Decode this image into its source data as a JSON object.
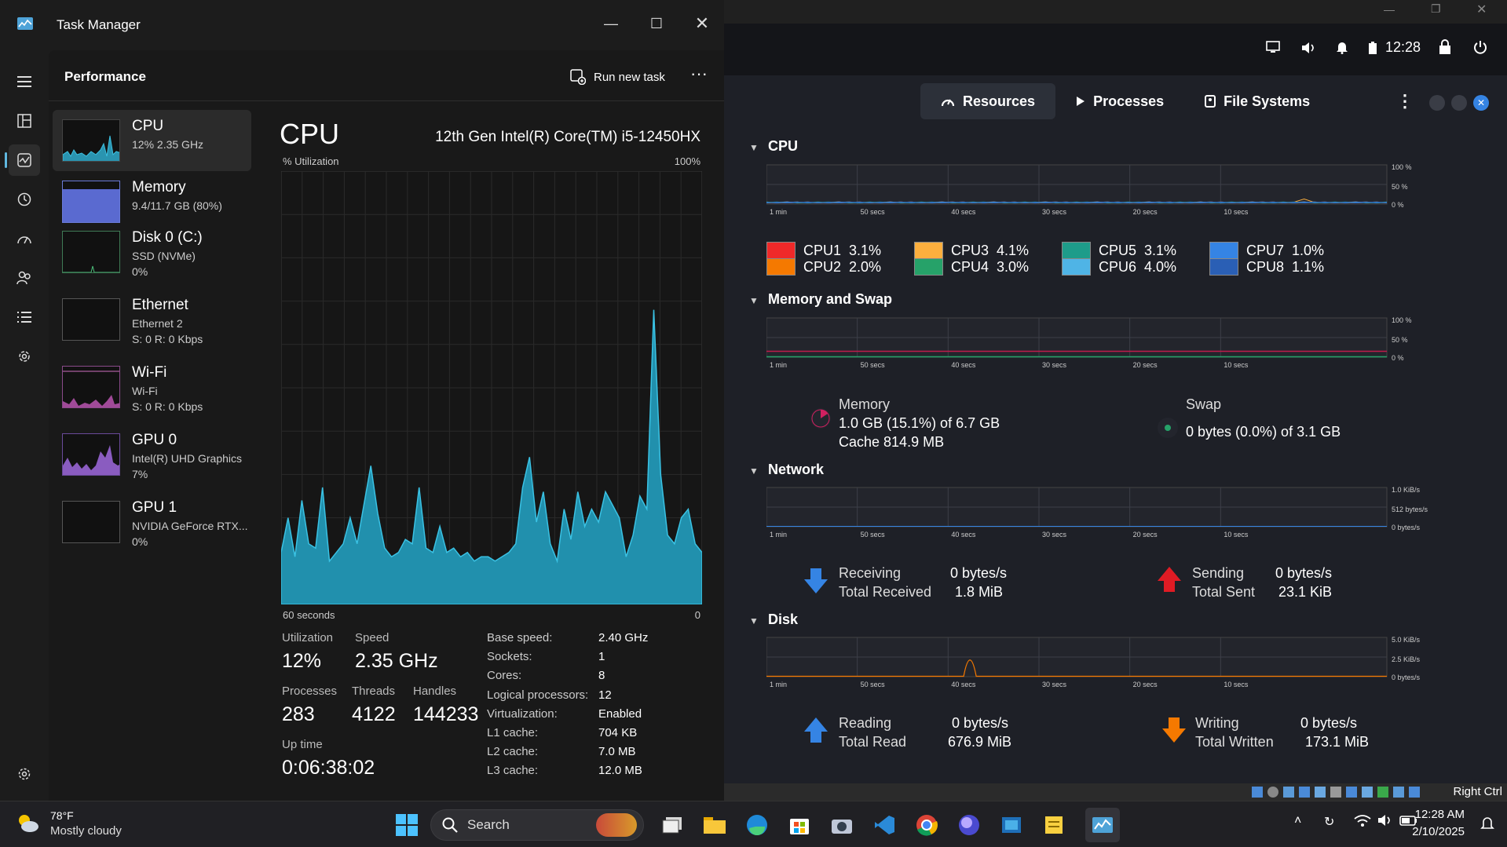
{
  "task_manager": {
    "title": "Task Manager",
    "page_title": "Performance",
    "run_new_task": "Run new task",
    "more": "···",
    "sidebar": [
      {
        "name": "CPU",
        "sub1": "12% 2.35 GHz",
        "sub2": ""
      },
      {
        "name": "Memory",
        "sub1": "9.4/11.7 GB (80%)",
        "sub2": ""
      },
      {
        "name": "Disk 0 (C:)",
        "sub1": "SSD (NVMe)",
        "sub2": "0%"
      },
      {
        "name": "Ethernet",
        "sub1": "Ethernet 2",
        "sub2": "S: 0 R: 0 Kbps"
      },
      {
        "name": "Wi-Fi",
        "sub1": "Wi-Fi",
        "sub2": "S: 0 R: 0 Kbps"
      },
      {
        "name": "GPU 0",
        "sub1": "Intel(R) UHD Graphics",
        "sub2": "7%"
      },
      {
        "name": "GPU 1",
        "sub1": "NVIDIA GeForce RTX...",
        "sub2": "0%"
      }
    ],
    "cpu": {
      "heading": "CPU",
      "model": "12th Gen Intel(R) Core(TM) i5-12450HX",
      "graph_label": "% Utilization",
      "graph_max": "100%",
      "graph_time": "60 seconds",
      "graph_zero": "0",
      "utilization_label": "Utilization",
      "utilization": "12%",
      "speed_label": "Speed",
      "speed": "2.35 GHz",
      "processes_label": "Processes",
      "processes": "283",
      "threads_label": "Threads",
      "threads": "4122",
      "handles_label": "Handles",
      "handles": "144233",
      "uptime_label": "Up time",
      "uptime": "0:06:38:02",
      "specs": [
        {
          "k": "Base speed:",
          "v": "2.40 GHz"
        },
        {
          "k": "Sockets:",
          "v": "1"
        },
        {
          "k": "Cores:",
          "v": "8"
        },
        {
          "k": "Logical processors:",
          "v": "12"
        },
        {
          "k": "Virtualization:",
          "v": "Enabled"
        },
        {
          "k": "L1 cache:",
          "v": "704 KB"
        },
        {
          "k": "L2 cache:",
          "v": "7.0 MB"
        },
        {
          "k": "L3 cache:",
          "v": "12.0 MB"
        }
      ],
      "history_percent": [
        12,
        20,
        11,
        24,
        14,
        13,
        27,
        10,
        12,
        14,
        20,
        14,
        23,
        32,
        21,
        13,
        11,
        12,
        15,
        14,
        27,
        13,
        12,
        18,
        12,
        13,
        11,
        12,
        10,
        11,
        11,
        10,
        11,
        12,
        14,
        27,
        34,
        19,
        26,
        14,
        10,
        22,
        15,
        26,
        18,
        22,
        19,
        26,
        23,
        20,
        11,
        16,
        25,
        22,
        68,
        30,
        16,
        14,
        20,
        22,
        14,
        12
      ]
    }
  },
  "system_monitor": {
    "tabs": [
      "Resources",
      "Processes",
      "File Systems"
    ],
    "time_labels": [
      "1 min",
      "50 secs",
      "40 secs",
      "30 secs",
      "20 secs",
      "10 secs"
    ],
    "cpu": {
      "title": "CPU",
      "axis": [
        "100 %",
        "50 %",
        "0 %"
      ],
      "cores": [
        {
          "name": "CPU1",
          "value": "3.1%",
          "color": "#ef2929"
        },
        {
          "name": "CPU2",
          "value": "2.0%",
          "color": "#f57900"
        },
        {
          "name": "CPU3",
          "value": "4.1%",
          "color": "#fcaf3e"
        },
        {
          "name": "CPU4",
          "value": "3.0%",
          "color": "#26a269"
        },
        {
          "name": "CPU5",
          "value": "3.1%",
          "color": "#1e9c8a"
        },
        {
          "name": "CPU6",
          "value": "4.0%",
          "color": "#4fb4e6"
        },
        {
          "name": "CPU7",
          "value": "1.0%",
          "color": "#3584e4"
        },
        {
          "name": "CPU8",
          "value": "1.1%",
          "color": "#2a5fb5"
        }
      ]
    },
    "memory": {
      "title": "Memory and Swap",
      "axis": [
        "100 %",
        "50 %",
        "0 %"
      ],
      "memory_label": "Memory",
      "memory_value": "1.0 GB (15.1%) of 6.7 GB",
      "cache": "Cache 814.9 MB",
      "swap_label": "Swap",
      "swap_value": "0 bytes (0.0%) of 3.1 GB"
    },
    "network": {
      "title": "Network",
      "axis": [
        "1.0 KiB/s",
        "512 bytes/s",
        "0 bytes/s"
      ],
      "receiving_label": "Receiving",
      "receiving": "0 bytes/s",
      "total_received_label": "Total Received",
      "total_received": "1.8 MiB",
      "sending_label": "Sending",
      "sending": "0 bytes/s",
      "total_sent_label": "Total Sent",
      "total_sent": "23.1 KiB"
    },
    "disk": {
      "title": "Disk",
      "axis": [
        "5.0 KiB/s",
        "2.5 KiB/s",
        "0 bytes/s"
      ],
      "reading_label": "Reading",
      "reading": "0 bytes/s",
      "total_read_label": "Total Read",
      "total_read": "676.9 MiB",
      "writing_label": "Writing",
      "writing": "0 bytes/s",
      "total_written_label": "Total Written",
      "total_written": "173.1 MiB"
    },
    "top_clock": "12:28",
    "host_key": "Right Ctrl"
  },
  "taskbar": {
    "weather_temp": "78°F",
    "weather_desc": "Mostly cloudy",
    "search_placeholder": "Search",
    "time": "12:28 AM",
    "date": "2/10/2025"
  }
}
